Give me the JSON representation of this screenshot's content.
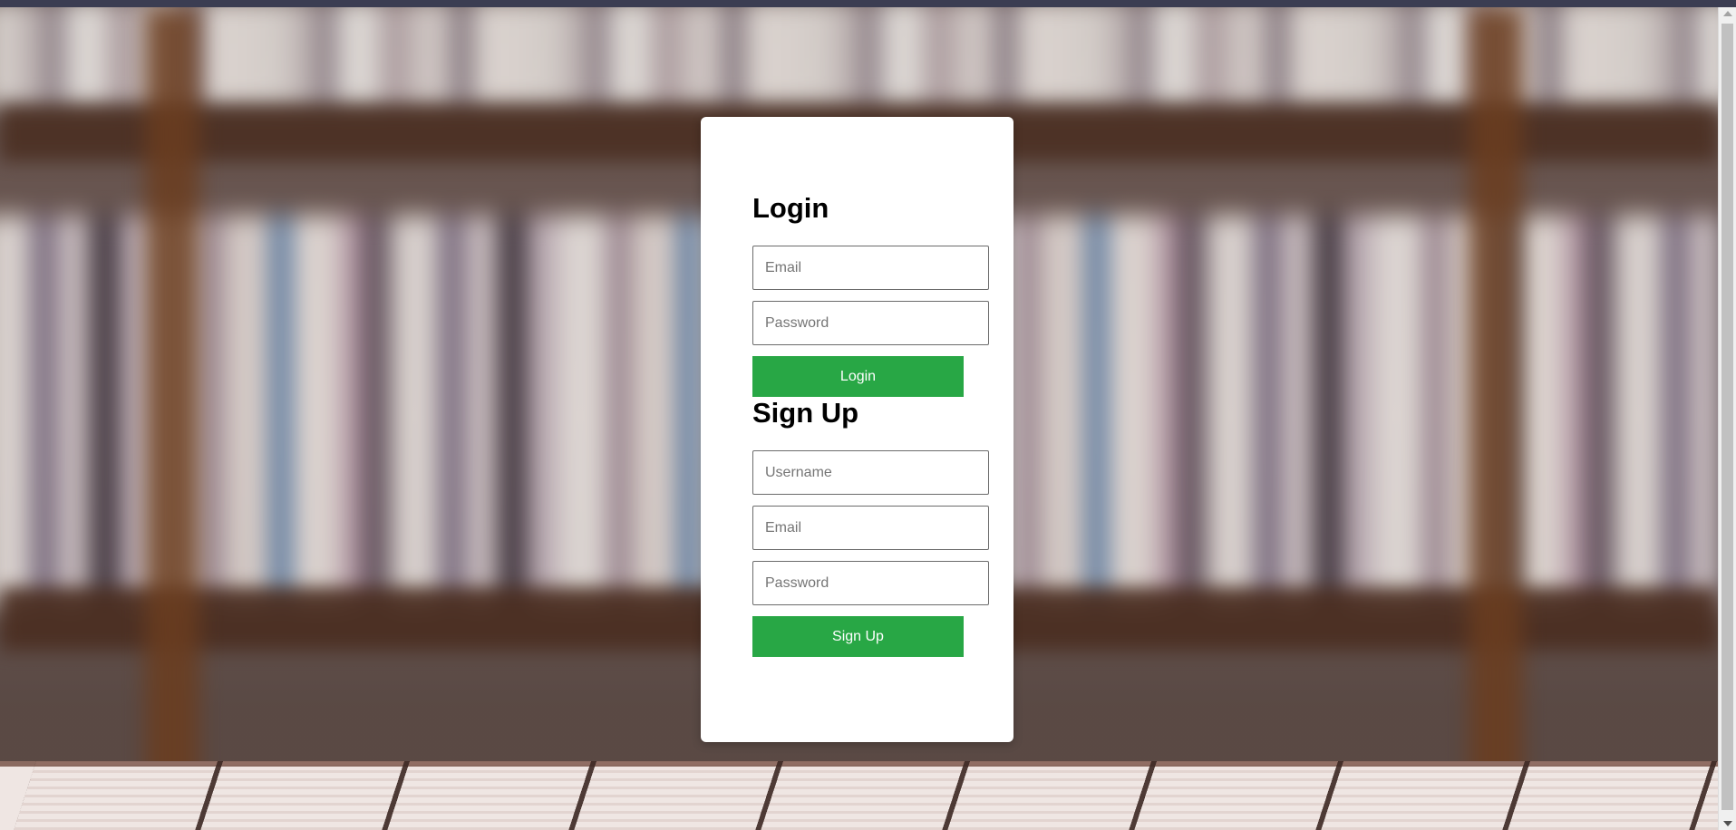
{
  "login": {
    "title": "Login",
    "email_placeholder": "Email",
    "password_placeholder": "Password",
    "button_label": "Login"
  },
  "signup": {
    "title": "Sign Up",
    "username_placeholder": "Username",
    "email_placeholder": "Email",
    "password_placeholder": "Password",
    "button_label": "Sign Up"
  },
  "colors": {
    "button": "#28a745",
    "card": "#ffffff"
  }
}
